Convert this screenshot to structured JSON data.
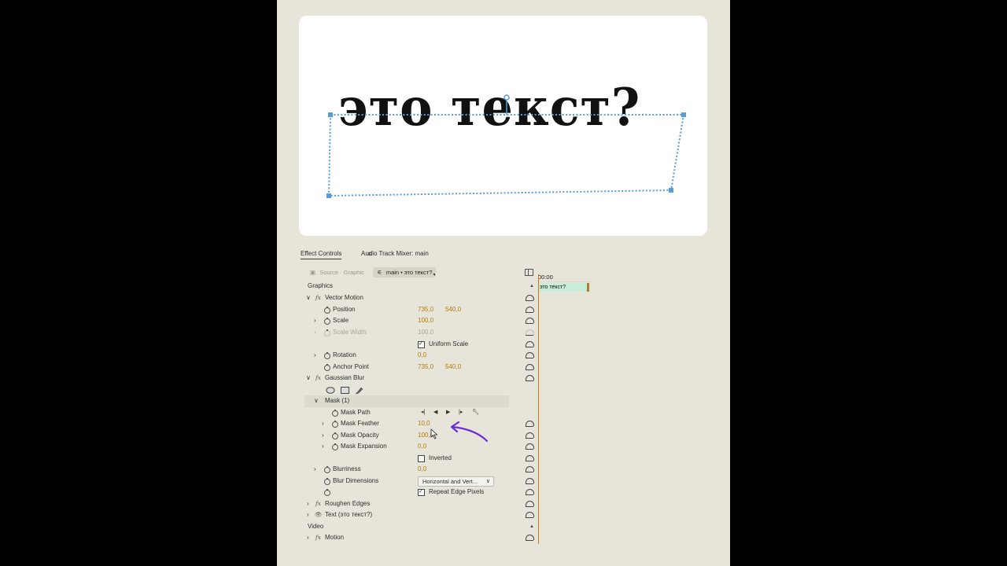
{
  "preview": {
    "text": "это текст?"
  },
  "tabs": {
    "effect_controls": "Effect Controls",
    "audio_mixer": "Audio Track Mixer: main"
  },
  "source_bar": {
    "source": "Source · Graphic",
    "sequence": "main • это текст?"
  },
  "timeline": {
    "timecode": "00:00",
    "clip_label": "это текст?"
  },
  "sections": {
    "graphics": "Graphics",
    "video": "Video"
  },
  "vector_motion": {
    "title": "Vector Motion",
    "position_label": "Position",
    "position_x": "735,0",
    "position_y": "540,0",
    "scale_label": "Scale",
    "scale_value": "100,0",
    "scale_width_label": "Scale Width",
    "scale_width_value": "100,0",
    "uniform_scale_label": "Uniform Scale",
    "rotation_label": "Rotation",
    "rotation_value": "0,0",
    "anchor_label": "Anchor Point",
    "anchor_x": "735,0",
    "anchor_y": "540,0"
  },
  "gaussian_blur": {
    "title": "Gaussian Blur",
    "mask_title": "Mask (1)",
    "mask_path_label": "Mask Path",
    "mask_feather_label": "Mask Feather",
    "mask_feather_value": "10,0",
    "mask_opacity_label": "Mask Opacity",
    "mask_opacity_value": "100,0",
    "mask_expansion_label": "Mask Expansion",
    "mask_expansion_value": "0,0",
    "inverted_label": "Inverted",
    "blurriness_label": "Blurriness",
    "blurriness_value": "0,0",
    "blur_dimensions_label": "Blur Dimensions",
    "blur_dimensions_value": "Horizontal and Vert...",
    "repeat_edge_label": "Repeat Edge Pixels"
  },
  "roughen_edges": {
    "title": "Roughen Edges"
  },
  "text_layer": {
    "title": "Text (это текст?)"
  },
  "motion": {
    "title": "Motion"
  },
  "colors": {
    "accent_value": "#b57a05",
    "mask_outline": "#5b9bd5",
    "annotation_arrow": "#6b2bd6",
    "playhead": "#c97c13"
  }
}
